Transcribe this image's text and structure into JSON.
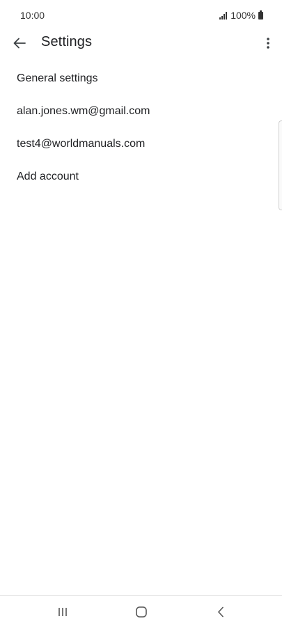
{
  "status_bar": {
    "time": "10:00",
    "battery_text": "100%"
  },
  "app_bar": {
    "title": "Settings",
    "back_icon": "arrow-back-icon",
    "more_icon": "more-vert-icon"
  },
  "settings_list": {
    "items": [
      {
        "label": "General settings"
      },
      {
        "label": "alan.jones.wm@gmail.com"
      },
      {
        "label": "test4@worldmanuals.com"
      },
      {
        "label": "Add account"
      }
    ]
  },
  "nav_bar": {
    "recents_icon": "recents-icon",
    "home_icon": "home-icon",
    "back_icon": "nav-back-icon"
  },
  "colors": {
    "text_primary": "#202124",
    "status_text": "#333333",
    "background": "#ffffff"
  }
}
